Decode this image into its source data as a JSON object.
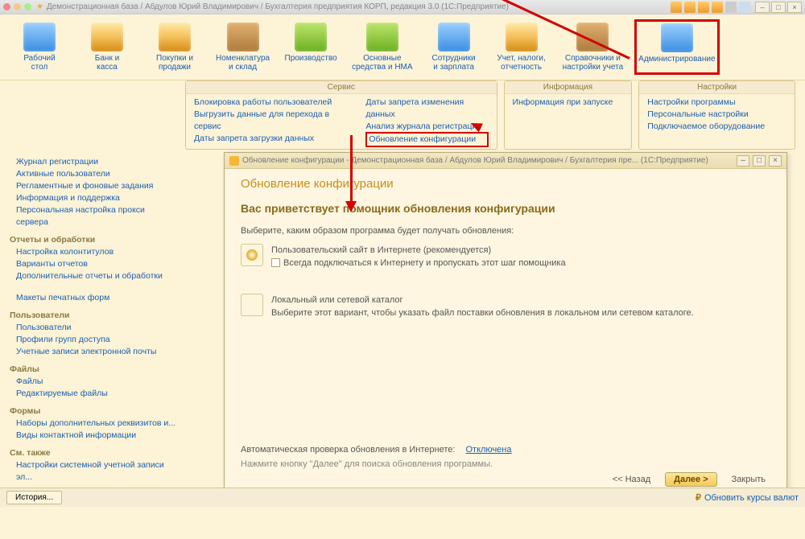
{
  "titlebar": {
    "text": "Демонстрационная база / Абдулов Юрий Владимирович / Бухгалтерия предприятия КОРП, редакция 3.0    (1С:Предприятие)"
  },
  "toolbar": [
    {
      "label": "Рабочий\nстол"
    },
    {
      "label": "Банк и\nкасса"
    },
    {
      "label": "Покупки и\nпродажи"
    },
    {
      "label": "Номенклатура\nи склад"
    },
    {
      "label": "Производство"
    },
    {
      "label": "Основные\nсредства и НМА"
    },
    {
      "label": "Сотрудники\nи зарплата"
    },
    {
      "label": "Учет, налоги,\nотчетность"
    },
    {
      "label": "Справочники и\nнастройки учета"
    },
    {
      "label": "Администрирование"
    }
  ],
  "sections": {
    "service": {
      "title": "Сервис",
      "col1": [
        "Блокировка работы пользователей",
        "Выгрузить данные для перехода в сервис",
        "Даты запрета загрузки данных"
      ],
      "col2": [
        "Даты запрета изменения данных",
        "Анализ журнала регистрации",
        "Обновление конфигурации"
      ]
    },
    "info": {
      "title": "Информация",
      "items": [
        "Информация при запуске"
      ]
    },
    "settings": {
      "title": "Настройки",
      "items": [
        "Настройки программы",
        "Персональные настройки",
        "Подключаемое оборудование"
      ]
    }
  },
  "leftnav": {
    "g0": [
      "Журнал регистрации",
      "Активные пользователи",
      "Регламентные и фоновые задания",
      "Информация и поддержка",
      "Персональная настройка прокси сервера"
    ],
    "g1_head": "Отчеты и обработки",
    "g1": [
      "Настройка колонтитулов",
      "Варианты отчетов",
      "Дополнительные отчеты и обработки"
    ],
    "g2": [
      "Макеты печатных форм"
    ],
    "g3_head": "Пользователи",
    "g3": [
      "Пользователи",
      "Профили групп доступа",
      "Учетные записи электронной почты"
    ],
    "g4_head": "Файлы",
    "g4": [
      "Файлы",
      "Редактируемые файлы"
    ],
    "g5_head": "Формы",
    "g5": [
      "Наборы дополнительных реквизитов и...",
      "Виды контактной информации"
    ],
    "g6_head": "См. также",
    "g6": [
      "Настройки системной учетной записи эл..."
    ]
  },
  "dialog": {
    "title": "Обновление конфигурации - Демонстрационная база / Абдулов Юрий Владимирович / Бухгалтерия пре...    (1С:Предприятие)",
    "h1": "Обновление конфигурации",
    "h2": "Вас приветствует помощник обновления конфигурации",
    "p1": "Выберите, каким образом программа будет получать обновления:",
    "opt1": "Пользовательский сайт в Интернете (рекомендуется)",
    "opt1_chk": "Всегда подключаться к Интернету и пропускать этот шаг помощника",
    "opt2": "Локальный или сетевой каталог",
    "opt2_sub": "Выберите этот вариант, чтобы указать файл поставки обновления в локальном или сетевом каталоге.",
    "auto": "Автоматическая проверка обновления в Интернете:",
    "auto_state": "Отключена",
    "hint": "Нажмите кнопку \"Далее\" для поиска обновления программы.",
    "back": "<< Назад",
    "next": "Далее >",
    "close": "Закрыть"
  },
  "statusbar": {
    "history": "История...",
    "rates": "Обновить курсы валют"
  }
}
